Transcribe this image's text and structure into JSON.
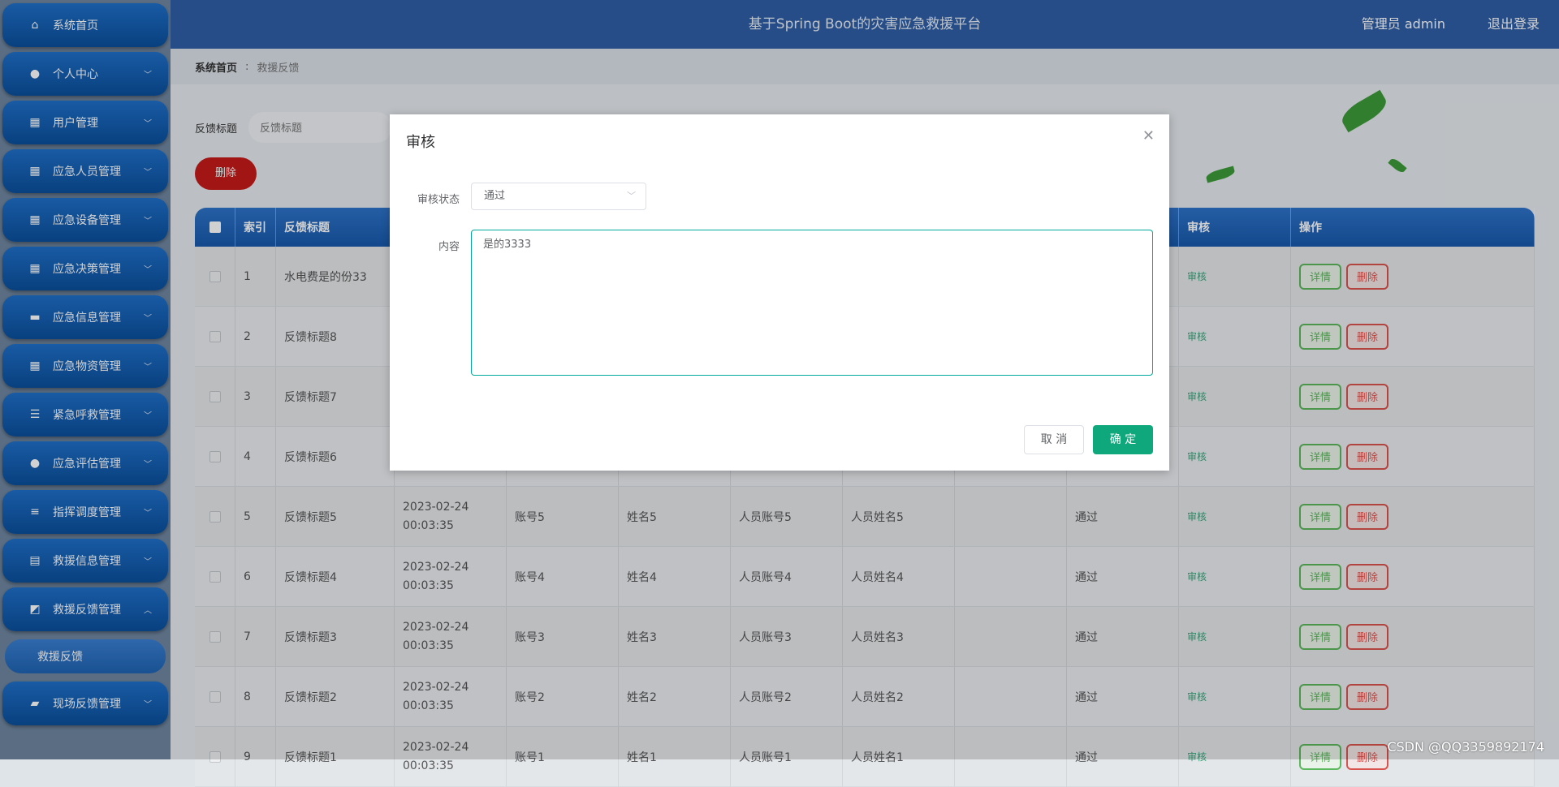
{
  "header": {
    "title": "基于Spring Boot的灾害应急救援平台",
    "admin": "管理员 admin",
    "logout": "退出登录"
  },
  "sidebar": {
    "items": [
      {
        "label": "系统首页",
        "icon": "home-icon"
      },
      {
        "label": "个人中心",
        "icon": "user-icon"
      },
      {
        "label": "用户管理",
        "icon": "grid-icon"
      },
      {
        "label": "应急人员管理",
        "icon": "grid-icon"
      },
      {
        "label": "应急设备管理",
        "icon": "grid-icon"
      },
      {
        "label": "应急决策管理",
        "icon": "grid-icon"
      },
      {
        "label": "应急信息管理",
        "icon": "chat-icon"
      },
      {
        "label": "应急物资管理",
        "icon": "grid-icon"
      },
      {
        "label": "紧急呼救管理",
        "icon": "list-icon"
      },
      {
        "label": "应急评估管理",
        "icon": "pin-icon"
      },
      {
        "label": "指挥调度管理",
        "icon": "sliders-icon"
      },
      {
        "label": "救援信息管理",
        "icon": "doc-icon"
      },
      {
        "label": "救援反馈管理",
        "icon": "chart-icon"
      },
      {
        "label": "现场反馈管理",
        "icon": "briefcase-icon"
      }
    ],
    "sub_item": "救援反馈"
  },
  "breadcrumb": {
    "home": "系统首页",
    "current": "救援反馈"
  },
  "search": {
    "label": "反馈标题",
    "placeholder": "反馈标题"
  },
  "toolbar": {
    "delete_label": "删除"
  },
  "table": {
    "headers": {
      "index": "索引",
      "title": "反馈标题",
      "audit": "审核",
      "op": "操作"
    },
    "rows": [
      {
        "idx": "1",
        "title": "水电费是的份33",
        "time": "",
        "acc": "",
        "name": "",
        "pacc": "",
        "pname": "",
        "status": "",
        "audit": "审核"
      },
      {
        "idx": "2",
        "title": "反馈标题8",
        "time": "",
        "acc": "",
        "name": "",
        "pacc": "",
        "pname": "",
        "status": "",
        "audit": "审核"
      },
      {
        "idx": "3",
        "title": "反馈标题7",
        "time": "",
        "acc": "",
        "name": "",
        "pacc": "",
        "pname": "",
        "status": "",
        "audit": "审核"
      },
      {
        "idx": "4",
        "title": "反馈标题6",
        "time": "",
        "acc": "",
        "name": "",
        "pacc": "",
        "pname": "",
        "status": "",
        "audit": "审核"
      },
      {
        "idx": "5",
        "title": "反馈标题5",
        "time": "2023-02-24 00:03:35",
        "acc": "账号5",
        "name": "姓名5",
        "pacc": "人员账号5",
        "pname": "人员姓名5",
        "status": "通过",
        "audit": "审核"
      },
      {
        "idx": "6",
        "title": "反馈标题4",
        "time": "2023-02-24 00:03:35",
        "acc": "账号4",
        "name": "姓名4",
        "pacc": "人员账号4",
        "pname": "人员姓名4",
        "status": "通过",
        "audit": "审核"
      },
      {
        "idx": "7",
        "title": "反馈标题3",
        "time": "2023-02-24 00:03:35",
        "acc": "账号3",
        "name": "姓名3",
        "pacc": "人员账号3",
        "pname": "人员姓名3",
        "status": "通过",
        "audit": "审核"
      },
      {
        "idx": "8",
        "title": "反馈标题2",
        "time": "2023-02-24 00:03:35",
        "acc": "账号2",
        "name": "姓名2",
        "pacc": "人员账号2",
        "pname": "人员姓名2",
        "status": "通过",
        "audit": "审核"
      },
      {
        "idx": "9",
        "title": "反馈标题1",
        "time": "2023-02-24 00:03:35",
        "acc": "账号1",
        "name": "姓名1",
        "pacc": "人员账号1",
        "pname": "人员姓名1",
        "status": "通过",
        "audit": "审核"
      }
    ],
    "detail_label": "详情",
    "delete_label": "删除"
  },
  "dialog": {
    "title": "审核",
    "status_label": "审核状态",
    "status_value": "通过",
    "content_label": "内容",
    "content_value": "是的3333",
    "cancel_label": "取 消",
    "confirm_label": "确 定"
  },
  "watermark": "CSDN @QQ3359892174",
  "colors": {
    "header": "#2f5fa6",
    "menu": "#1f6fc9",
    "confirm": "#0fa87c",
    "detail": "#5cb85c",
    "delete": "#d9534f"
  }
}
